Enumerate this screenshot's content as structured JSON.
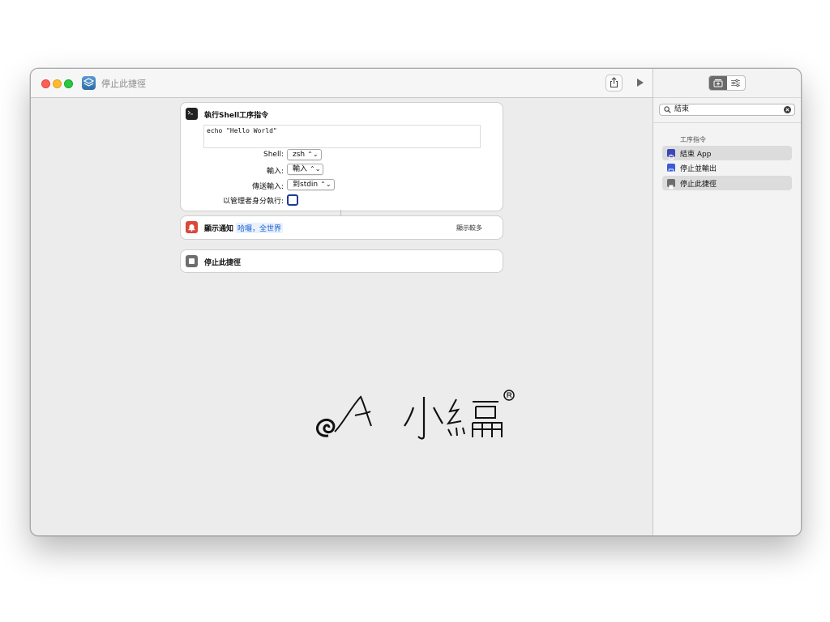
{
  "window": {
    "title": "停止此捷徑"
  },
  "actions": {
    "shell": {
      "title": "執行Shell工序指令",
      "script": "echo \"Hello World\"",
      "params": [
        {
          "label": "Shell:",
          "value": "zsh"
        },
        {
          "label": "輸入:",
          "value": "輸入"
        },
        {
          "label": "傳送輸入:",
          "value": "到stdin"
        }
      ],
      "admin_label": "以管理者身分執行:"
    },
    "notify": {
      "title": "顯示通知",
      "text": "哈囉，全世界",
      "show_more": "顯示較多"
    },
    "stop": {
      "title": "停止此捷徑"
    }
  },
  "sidebar": {
    "search_value": "結束",
    "section_label": "工序指令",
    "items": [
      {
        "label": "結束 App",
        "color": "#3b47b8"
      },
      {
        "label": "停止並輸出",
        "color": "#3b5bd8"
      },
      {
        "label": "停止此捷徑",
        "color": "#6e6e6e"
      }
    ]
  },
  "colors": {
    "accent": "#1a5fd8",
    "notify_icon": "#d9483b",
    "shell_icon": "#222222",
    "stop_icon": "#6e6e6e"
  }
}
